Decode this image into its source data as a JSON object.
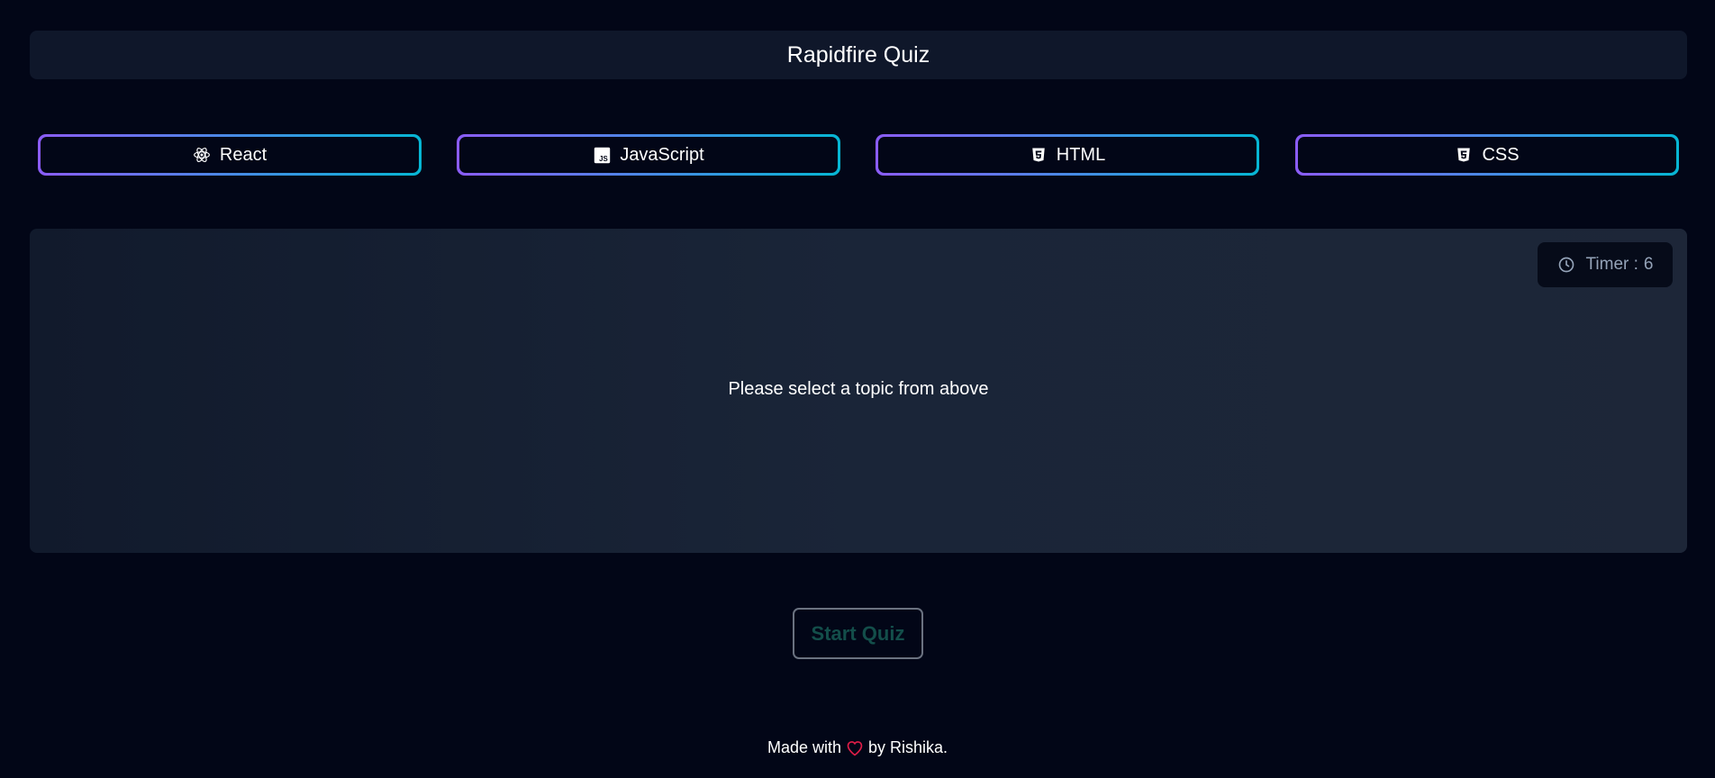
{
  "header": {
    "title": "Rapidfire Quiz"
  },
  "topics": [
    {
      "label": "React",
      "icon": "react-icon"
    },
    {
      "label": "JavaScript",
      "icon": "javascript-icon"
    },
    {
      "label": "HTML",
      "icon": "html5-icon"
    },
    {
      "label": "CSS",
      "icon": "css3-icon"
    }
  ],
  "quiz": {
    "timer_label": "Timer :",
    "timer_value": "6",
    "timer_icon": "clock-icon",
    "prompt": "Please select a topic from above"
  },
  "start_button": {
    "label": "Start Quiz"
  },
  "footer": {
    "before": "Made with",
    "heart_icon": "heart-icon",
    "after": "by Rishika."
  },
  "colors": {
    "background": "#020617",
    "panel": "#0f172a",
    "gradient_start": "#8b5cf6",
    "gradient_end": "#06b6d4",
    "heart": "#e11d48",
    "start_text": "#134e4a"
  }
}
